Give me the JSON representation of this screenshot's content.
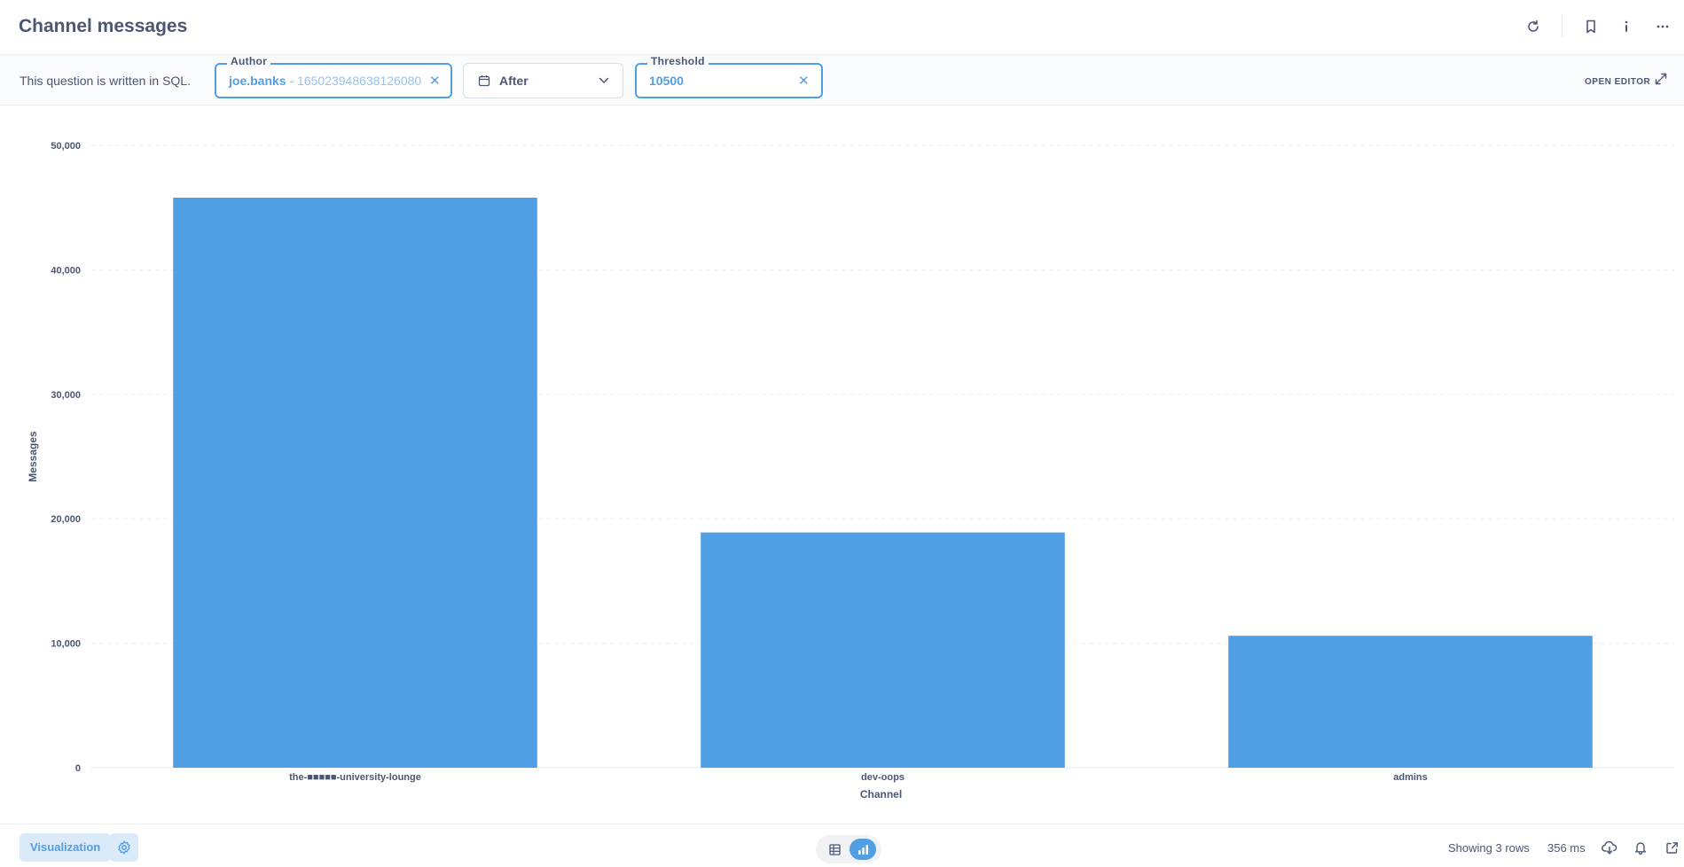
{
  "header": {
    "title": "Channel messages",
    "actions": [
      "refresh-icon",
      "bookmark-icon",
      "info-icon",
      "more-icon"
    ]
  },
  "filters": {
    "sql_note": "This question is written in SQL.",
    "author": {
      "label": "Author",
      "value": "joe.banks",
      "separator": " - ",
      "id": "165023948638126080"
    },
    "date": {
      "value": "After"
    },
    "threshold": {
      "label": "Threshold",
      "value": "10500"
    },
    "open_editor": "OPEN EDITOR"
  },
  "chart_data": {
    "type": "bar",
    "categories": [
      "the-■■■■■-university-lounge",
      "dev-oops",
      "admins"
    ],
    "values": [
      45800,
      18900,
      10600
    ],
    "xlabel": "Channel",
    "ylabel": "Messages",
    "ylim": [
      0,
      50000
    ],
    "yticks": [
      0,
      10000,
      20000,
      30000,
      40000,
      50000
    ],
    "ytick_labels": [
      "0",
      "10,000",
      "20,000",
      "30,000",
      "40,000",
      "50,000"
    ],
    "grid": true,
    "bar_color": "#509ee3"
  },
  "footer": {
    "visualization": "Visualization",
    "rows": "Showing 3 rows",
    "time": "356 ms"
  },
  "colors": {
    "brand": "#509ee3",
    "text": "#4c5773"
  }
}
